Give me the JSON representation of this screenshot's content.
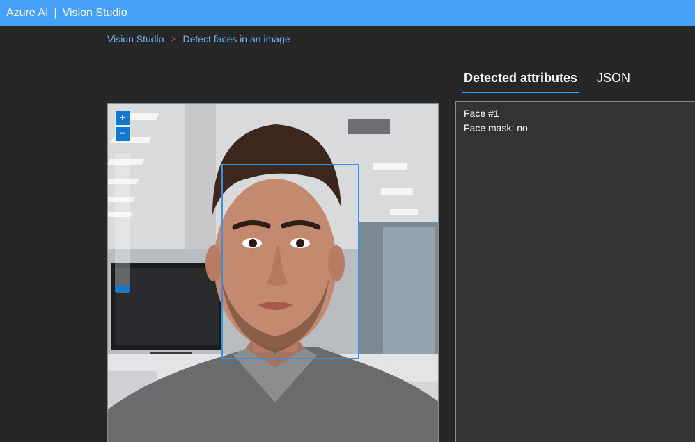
{
  "app": {
    "brand": "Azure AI",
    "separator": "|",
    "product": "Vision Studio"
  },
  "breadcrumb": {
    "items": [
      "Vision Studio",
      "Detect faces in an image"
    ],
    "separator": ">"
  },
  "tabs": [
    {
      "label": "Detected attributes",
      "active": true
    },
    {
      "label": "JSON",
      "active": false
    }
  ],
  "zoom": {
    "plus": "+",
    "minus": "−",
    "level": 0.05
  },
  "results": {
    "face_label": "Face #1",
    "mask_line": "Face mask: no"
  },
  "colors": {
    "topbar": "#46a0f8",
    "accent": "#0f78d4",
    "face_box": "#3a8fe6",
    "breadcrumb": "#6fb1f5"
  }
}
